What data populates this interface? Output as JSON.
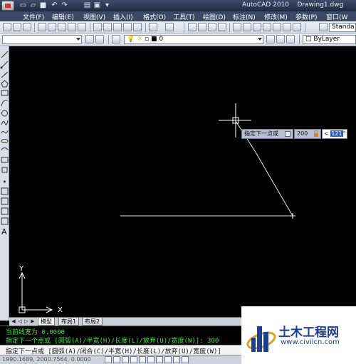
{
  "window": {
    "app_title": "AutoCAD 2010",
    "document": "Drawing1.dwg"
  },
  "menu": [
    {
      "label": "文件(F)"
    },
    {
      "label": "编辑(E)"
    },
    {
      "label": "视图(V)"
    },
    {
      "label": "插入(I)"
    },
    {
      "label": "格式(O)"
    },
    {
      "label": "工具(T)"
    },
    {
      "label": "绘图(D)"
    },
    {
      "label": "标注(N)"
    },
    {
      "label": "修改(M)"
    },
    {
      "label": "参数(P)"
    },
    {
      "label": "窗口(W"
    }
  ],
  "toolbar": {
    "style_combo": "Standa",
    "layer_combo": "0",
    "linetype_combo": "ByLayer"
  },
  "dynamic_input": {
    "prompt": "指定下一点或",
    "length": "200",
    "angle_prefix": "<",
    "angle": "121",
    "angle_suffix": "°"
  },
  "tabs": [
    {
      "label": "模型",
      "active": true
    },
    {
      "label": "布局1",
      "active": false
    },
    {
      "label": "布局2",
      "active": false
    }
  ],
  "command": {
    "line1": "当前线宽为 0.0000",
    "line2": "指定下一个点或 [圆弧(A)/半宽(H)/长度(L)/放弃(U)/宽度(W)]: 300",
    "input": "指定下一点或 [圆弧(A)/闭合(C)/半宽(H)/长度(L)/放弃(U)/宽度(W)]"
  },
  "status": {
    "coords": "1990.1689, 2000.7564, 0.0000"
  },
  "ucs": {
    "x_label": "X",
    "y_label": "Y"
  },
  "watermark": {
    "title": "土木工程网",
    "url": "www.civilcn.com"
  },
  "colors": {
    "canvas_bg": "#000000",
    "command_text": "#3fe03f",
    "tooltip_bg": "#b6bfd4"
  }
}
